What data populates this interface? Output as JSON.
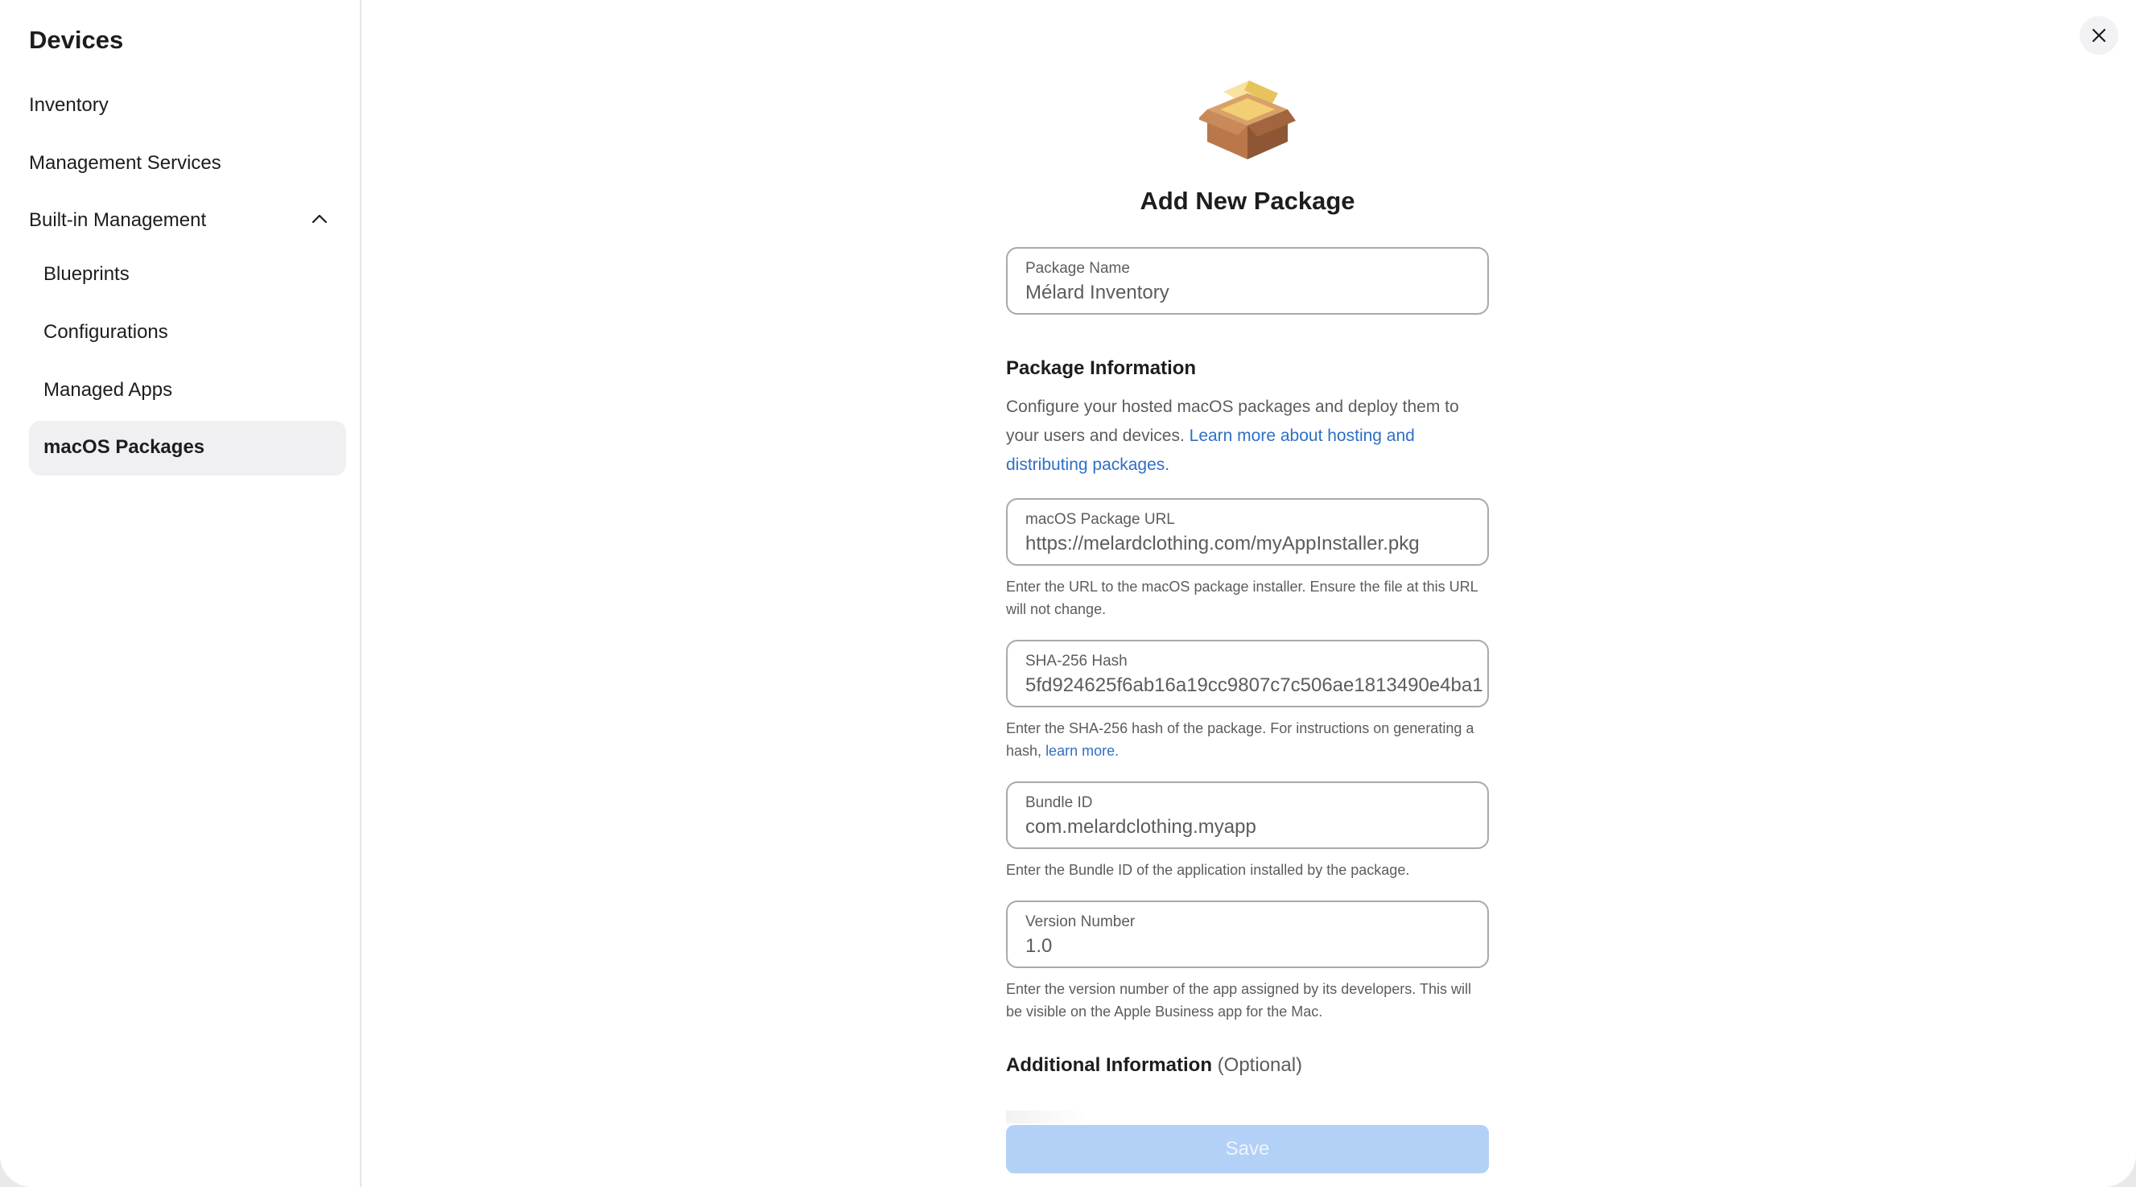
{
  "sidebar": {
    "title": "Devices",
    "items": [
      {
        "label": "Inventory"
      },
      {
        "label": "Management Services"
      },
      {
        "label": "Built-in Management"
      }
    ],
    "subitems": [
      {
        "label": "Blueprints"
      },
      {
        "label": "Configurations"
      },
      {
        "label": "Managed Apps"
      },
      {
        "label": "macOS Packages"
      }
    ],
    "selected": "macOS Packages"
  },
  "form": {
    "title": "Add New Package",
    "package_name": {
      "label": "Package Name",
      "value": "Mélard Inventory"
    },
    "package_info": {
      "heading": "Package Information",
      "description": "Configure your hosted macOS packages and deploy them to your users and devices.",
      "link_text": "Learn more about hosting and distributing packages."
    },
    "package_url": {
      "label": "macOS Package URL",
      "value": "https://melardclothing.com/myAppInstaller.pkg",
      "help": "Enter the URL to the macOS package installer. Ensure the file at this URL will not change."
    },
    "sha_hash": {
      "label": "SHA-256 Hash",
      "value": "5fd924625f6ab16a19cc9807c7c506ae1813490e4ba1",
      "help_prefix": "Enter the SHA-256 hash of the package. For instructions on generating a hash,",
      "help_link": "learn more."
    },
    "bundle_id": {
      "label": "Bundle ID",
      "value": "com.melardclothing.myapp",
      "help": "Enter the Bundle ID of the application installed by the package."
    },
    "version": {
      "label": "Version Number",
      "value": "1.0",
      "help": "Enter the version number of the app assigned by its developers. This will be visible on the Apple Business app for the Mac."
    },
    "additional": {
      "heading": "Additional Information",
      "optional": "(Optional)"
    },
    "save_label": "Save"
  },
  "icons": {
    "close": "close-icon",
    "chevron": "chevron-up-icon",
    "package": "package-icon"
  },
  "colors": {
    "accent_link": "#2f6fc4",
    "save_disabled": "#b3d0f7",
    "selected_bg": "#f0f0f2"
  }
}
